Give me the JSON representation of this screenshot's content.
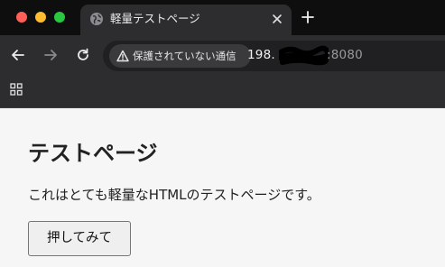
{
  "window": {
    "controls": [
      "close",
      "minimize",
      "zoom"
    ]
  },
  "tab": {
    "title": "軽量テストページ",
    "favicon": "globe-icon",
    "close_icon": "close-icon",
    "new_tab_icon": "plus-icon"
  },
  "toolbar": {
    "back_icon": "arrow-left-icon",
    "forward_icon": "arrow-right-icon",
    "reload_icon": "reload-icon",
    "security_label": "保護されていない通信",
    "security_icon": "warning-triangle-icon",
    "url_host_prefix": "198.",
    "url_port": ":8080"
  },
  "bookmarks": {
    "apps_icon": "apps-grid-icon"
  },
  "page": {
    "heading": "テストページ",
    "paragraph": "これはとても軽量なHTMLのテストページです。",
    "button_label": "押してみて"
  },
  "colors": {
    "tabstrip_bg": "#0e0e0f",
    "toolbar_bg": "#2d2d30",
    "page_bg": "#f6f6f6",
    "traffic_red": "#fe5f57",
    "traffic_yellow": "#febc2e",
    "traffic_green": "#28c840"
  }
}
